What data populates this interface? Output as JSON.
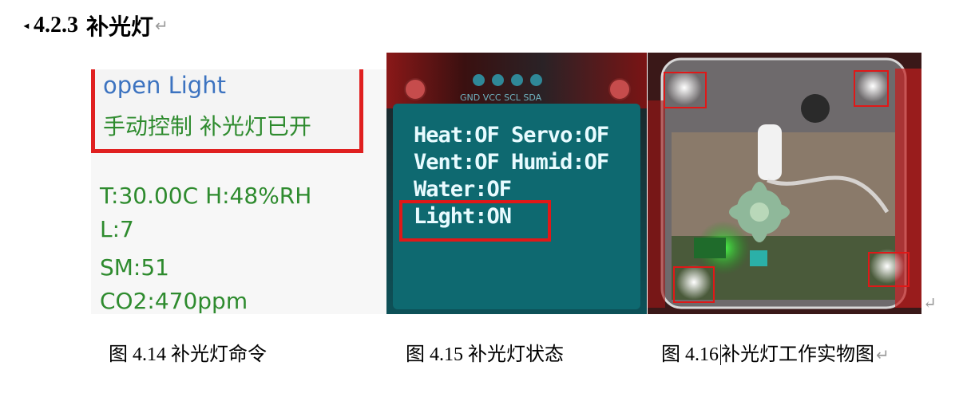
{
  "heading": {
    "number": "4.2.3",
    "title": "补光灯"
  },
  "figure1": {
    "open_text": "open Light",
    "manual_text": "手动控制 补光灯已开",
    "readings": [
      "T:30.00C H:48%RH",
      "L:7",
      "SM:51",
      "CO2:470ppm"
    ]
  },
  "figure2": {
    "pins": "GND VCC SCL SDA",
    "lines": [
      "Heat:OF Servo:OF",
      "Vent:OF Humid:OF",
      "Water:OF",
      "Light:ON"
    ]
  },
  "captions": {
    "c1": "图 4.14 补光灯命令",
    "c2": "图 4.15 补光灯状态",
    "c3_a": "图 4.16",
    "c3_b": "补光灯工作实物图"
  },
  "return_mark": "↵"
}
